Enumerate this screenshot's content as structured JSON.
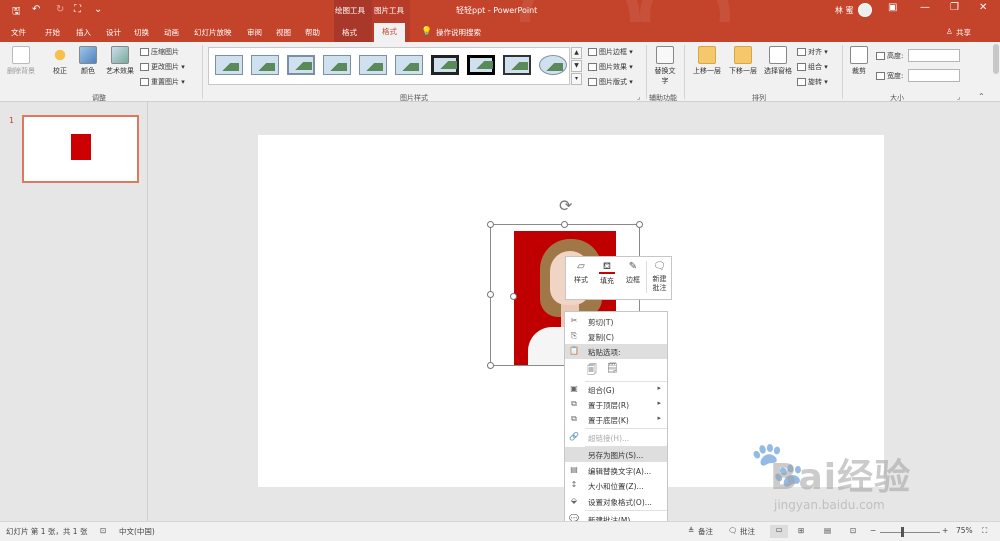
{
  "window": {
    "title": "轻轻ppt - PowerPoint",
    "context_group_drawing": "绘图工具",
    "context_group_picture": "图片工具",
    "user": "林 蜜",
    "share": "共享"
  },
  "qat": {
    "save": "🖫",
    "undo": "↶",
    "redo": "↻",
    "start": "⛶",
    "custom": "⌄"
  },
  "tabs": [
    "文件",
    "开始",
    "插入",
    "设计",
    "切换",
    "动画",
    "幻灯片放映",
    "审阅",
    "视图",
    "帮助",
    "格式",
    "格式",
    "操作说明搜索"
  ],
  "ribbon": {
    "adjust": {
      "remove_bg": "删除背景",
      "correct": "校正",
      "color": "颜色",
      "artistic": "艺术效果",
      "compress": "压缩图片",
      "change": "更改图片",
      "reset": "重置图片",
      "label": "调整"
    },
    "styles": {
      "border": "图片边框",
      "effects": "图片效果",
      "layout": "图片版式",
      "label": "图片样式"
    },
    "accessibility": {
      "alt_text": "替换文字",
      "label": "辅助功能"
    },
    "arrange": {
      "forward": "上移一层",
      "backward": "下移一层",
      "pane": "选择窗格",
      "align": "对齐",
      "group": "组合",
      "rotate": "旋转",
      "label": "排列"
    },
    "size": {
      "crop": "裁剪",
      "height_label": "高度:",
      "width_label": "宽度:",
      "height_value": "",
      "width_value": "",
      "label": "大小"
    }
  },
  "slides_panel": {
    "number": "1"
  },
  "mini_toolbar": [
    {
      "label": "样式"
    },
    {
      "label": "填充"
    },
    {
      "label": "边框"
    },
    {
      "label": "新建批注"
    }
  ],
  "context_menu": [
    {
      "label": "剪切(T)",
      "icon": "✂"
    },
    {
      "label": "复制(C)",
      "icon": "⎘"
    },
    {
      "label": "粘贴选项:",
      "icon": "📋"
    },
    {
      "label": "组合(G)",
      "icon": "▣"
    },
    {
      "label": "置于顶层(R)",
      "icon": "⧉"
    },
    {
      "label": "置于底层(K)",
      "icon": "⧉"
    },
    {
      "label": "超链接(H)...",
      "icon": "🔗"
    },
    {
      "label": "另存为图片(S)...",
      "icon": ""
    },
    {
      "label": "编辑替换文字(A)...",
      "icon": "▤"
    },
    {
      "label": "大小和位置(Z)...",
      "icon": "↕"
    },
    {
      "label": "设置对象格式(O)...",
      "icon": "⬙"
    },
    {
      "label": "新建批注(M)",
      "icon": "💬"
    }
  ],
  "status": {
    "slide_info": "幻灯片 第 1 张，共 1 张",
    "lang": "中文(中国)",
    "notes": "备注",
    "comments": "批注",
    "zoom": "75%"
  },
  "watermark": {
    "brand": "Bai经验",
    "url": "jingyan.baidu.com"
  },
  "colors": {
    "accent": "#c4432b",
    "photo_bg": "#c00000"
  }
}
